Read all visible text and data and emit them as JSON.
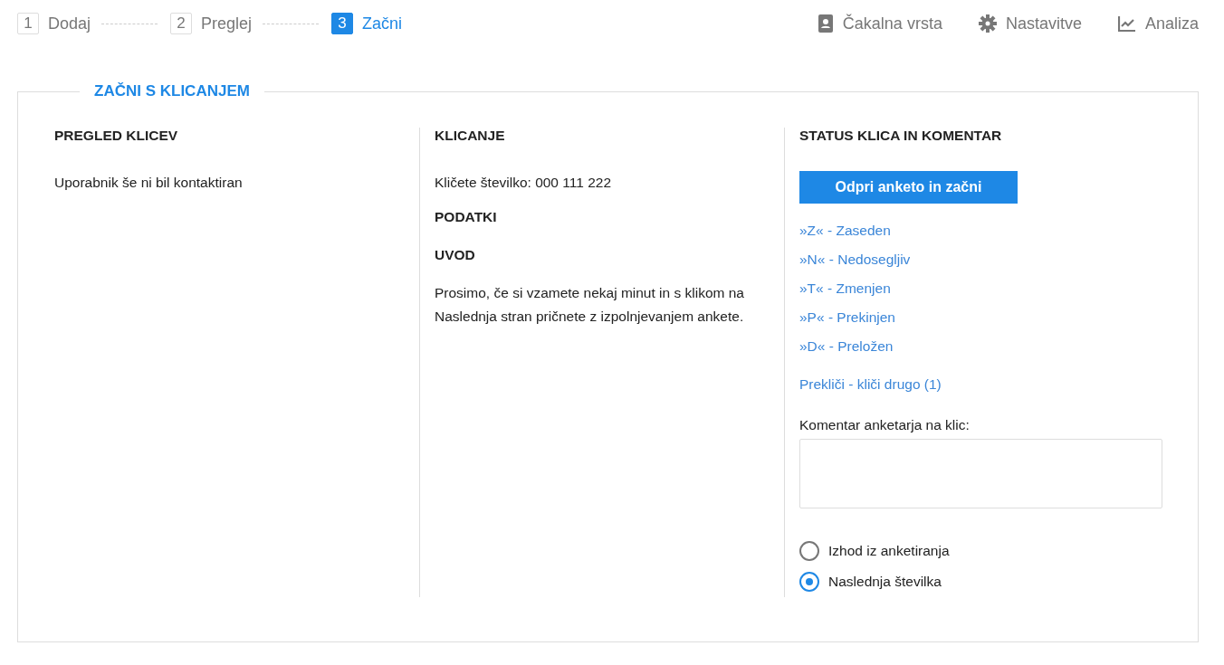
{
  "steps": [
    {
      "number": "1",
      "label": "Dodaj",
      "selected": false
    },
    {
      "number": "2",
      "label": "Preglej",
      "selected": false
    },
    {
      "number": "3",
      "label": "Začni",
      "selected": true
    }
  ],
  "top_links": [
    {
      "kind": "contacts",
      "label": "Čakalna vrsta"
    },
    {
      "kind": "settings",
      "label": "Nastavitve"
    },
    {
      "kind": "chart",
      "label": "Analiza"
    }
  ],
  "panel": {
    "title": "ZAČNI S KLICANJEM",
    "overview": {
      "heading": "PREGLED KLICEV",
      "text": "Uporabnik še ni bil kontaktiran"
    },
    "calling": {
      "heading": "KLICANJE",
      "number_text": "Kličete številko: 000 111 222",
      "data_heading": "PODATKI",
      "intro_heading": "UVOD",
      "intro_text": "Prosimo, če si vzamete nekaj minut in s klikom na Naslednja stran pričnete z izpolnjevanjem ankete."
    },
    "status": {
      "heading": "STATUS KLICA IN KOMENTAR",
      "button": "Odpri anketo in začni",
      "status_links": [
        "»Z« - Zaseden",
        "»N« - Nedosegljiv",
        "»T« - Zmenjen",
        "»P« - Prekinjen",
        "»D« - Preložen"
      ],
      "cancel_link": "Prekliči - kliči drugo (1)",
      "comment_label": "Komentar anketarja na klic:",
      "options": [
        {
          "label": "Izhod iz anketiranja",
          "selected": false
        },
        {
          "label": "Naslednja številka",
          "selected": true
        }
      ]
    }
  }
}
